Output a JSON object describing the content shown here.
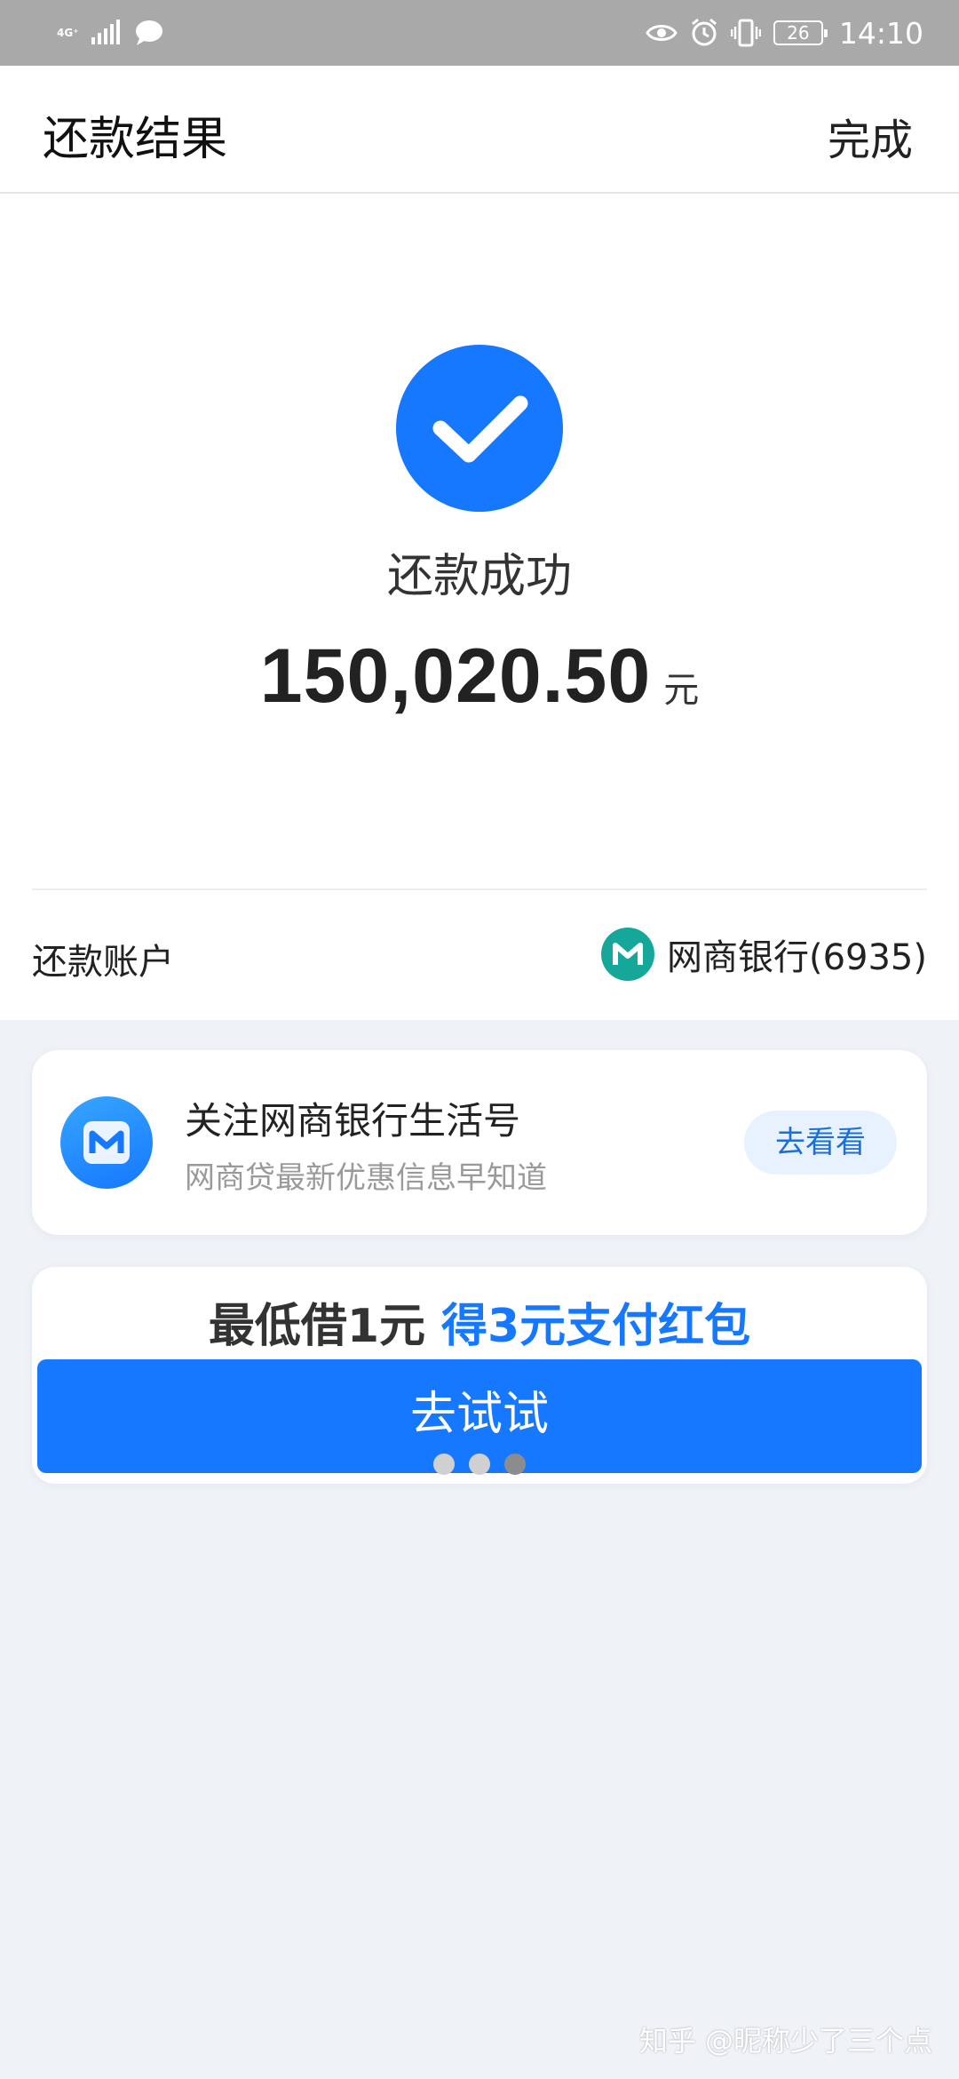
{
  "status_bar": {
    "signal_label": "4G⁺",
    "time": "14:10",
    "battery": "26",
    "icons": [
      "signal-icon",
      "message-icon",
      "eye-icon",
      "alarm-icon",
      "vibrate-icon",
      "battery-icon"
    ]
  },
  "header": {
    "title": "还款结果",
    "done_label": "完成"
  },
  "result": {
    "status_text": "还款成功",
    "amount": "150,020.50",
    "unit": "元",
    "account_label": "还款账户",
    "account_value": "网商银行(6935)",
    "icon": "check-icon"
  },
  "follow_card": {
    "title": "关注网商银行生活号",
    "subtitle": "网商贷最新优惠信息早知道",
    "button_label": "去看看"
  },
  "promo_card": {
    "text_dark": "最低借1元",
    "text_blue": "得3元支付红包",
    "button_label": "去试试",
    "dots_total": 3,
    "active_dot": 3
  },
  "watermark": "知乎 @昵称少了三个点",
  "colors": {
    "accent": "#1677ff",
    "bank_logo": "#15a89a",
    "page_bg": "#eff2f7",
    "status_bar_bg": "#a9a9a9"
  }
}
